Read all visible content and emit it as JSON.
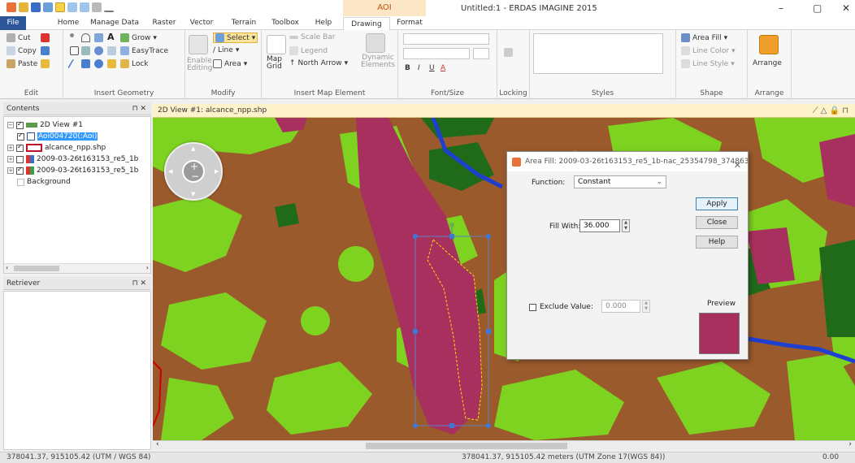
{
  "window": {
    "title": "Untitled:1 - ERDAS IMAGINE 2015",
    "context_tab_group": "AOI",
    "minimize_glyph": "–",
    "restore_glyph": "▢",
    "close_glyph": "✕"
  },
  "tabs": {
    "file": "File",
    "home": "Home",
    "manage_data": "Manage Data",
    "raster": "Raster",
    "vector": "Vector",
    "terrain": "Terrain",
    "toolbox": "Toolbox",
    "help": "Help",
    "drawing": "Drawing",
    "format": "Format"
  },
  "ribbon": {
    "edit": {
      "label": "Edit",
      "cut": "Cut",
      "copy": "Copy",
      "paste": "Paste"
    },
    "insert_geometry": {
      "label": "Insert Geometry",
      "text": "A",
      "grow": "Grow",
      "easytrace": "EasyTrace",
      "lock": "Lock"
    },
    "modify": {
      "label": "Modify",
      "enable_editing": "Enable Editing",
      "select": "Select",
      "line": "Line",
      "area": "Area"
    },
    "insert_map_element": {
      "label": "Insert Map Element",
      "map_grid": "Map Grid",
      "scale_bar": "Scale Bar",
      "legend": "Legend",
      "north_arrow": "North Arrow",
      "dynamic_elements": "Dynamic Elements"
    },
    "font_size": {
      "label": "Font/Size",
      "bold": "B",
      "italic": "I",
      "underline": "U",
      "font_color": "A"
    },
    "locking": {
      "label": "Locking"
    },
    "styles": {
      "label": "Styles"
    },
    "shape": {
      "label": "Shape",
      "area_fill": "Area Fill",
      "line_color": "Line Color",
      "line_style": "Line Style"
    },
    "arrange": {
      "label": "Arrange",
      "arrange_btn": "Arrange"
    }
  },
  "contents": {
    "title": "Contents",
    "pin": "⊓ ✕",
    "items": [
      {
        "label": "2D View #1",
        "checked": true
      },
      {
        "label": "Aoi004720(:Aoi)",
        "checked": true,
        "selected": true
      },
      {
        "label": "alcance_npp.shp",
        "checked": true
      },
      {
        "label": "2009-03-26t163153_re5_1b",
        "checked": false
      },
      {
        "label": "2009-03-26t163153_re5_1b",
        "checked": true
      },
      {
        "label": "Background",
        "checked": false
      }
    ]
  },
  "retriever": {
    "title": "Retriever",
    "pin": "⊓ ✕"
  },
  "view": {
    "title": "2D View #1: alcance_npp.shp",
    "right_icons": "⟋ △ 🔒 ⊓"
  },
  "dialog": {
    "title": "Area Fill: 2009-03-26t163153_re5_1b-nac_25354798_374863_...",
    "function_label": "Function:",
    "function_value": "Constant",
    "fill_with_label": "Fill With:",
    "fill_with_value": "36.000",
    "exclude_label": "Exclude Value:",
    "exclude_value": "0.000",
    "exclude_checked": false,
    "preview_label": "Preview",
    "apply": "Apply",
    "close": "Close",
    "help": "Help",
    "preview_color": "#a8305e"
  },
  "status": {
    "left_coords": "378041.37, 915105.42  (UTM / WGS 84)",
    "center_coords": "378041.37, 915105.42 meters (UTM Zone 17(WGS 84))",
    "right_value": "0.00"
  },
  "colors": {
    "ribbon_bg": "#f7f7f7",
    "file_tab": "#2b579a",
    "aoi_context": "#fbe7c6",
    "map_brown": "#9b5a2c",
    "map_green": "#7ed321",
    "map_dark_green": "#1f6b1a",
    "map_magenta": "#a8305e",
    "map_blue": "#1f3fd0"
  }
}
